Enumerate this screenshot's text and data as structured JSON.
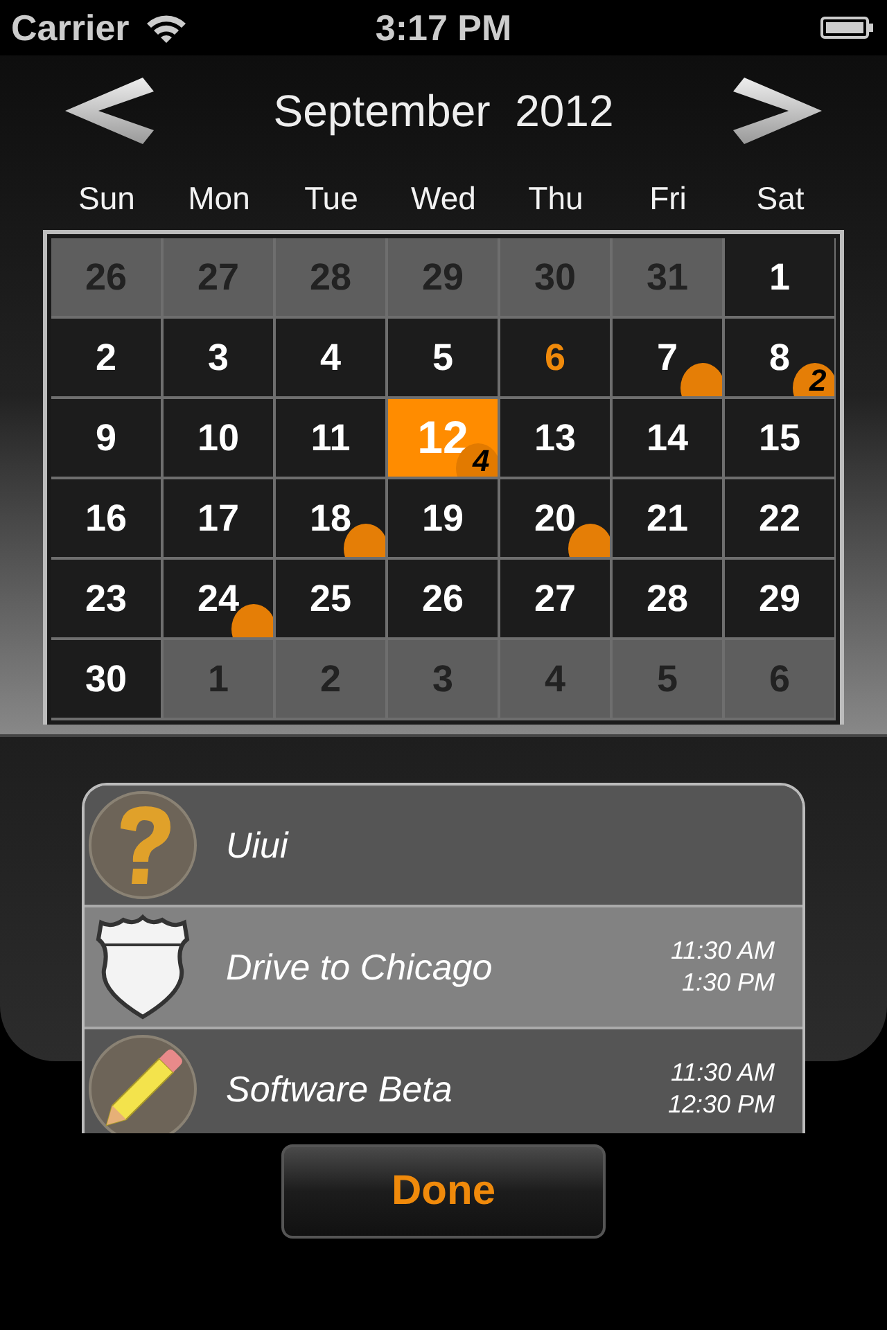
{
  "status_bar": {
    "carrier": "Carrier",
    "time": "3:17 PM"
  },
  "calendar": {
    "title": "September  2012",
    "weekdays": [
      "Sun",
      "Mon",
      "Tue",
      "Wed",
      "Thu",
      "Fri",
      "Sat"
    ],
    "days": [
      {
        "label": "26",
        "in_month": false,
        "today": false,
        "selected": false,
        "events": false
      },
      {
        "label": "27",
        "in_month": false,
        "today": false,
        "selected": false,
        "events": false
      },
      {
        "label": "28",
        "in_month": false,
        "today": false,
        "selected": false,
        "events": false
      },
      {
        "label": "29",
        "in_month": false,
        "today": false,
        "selected": false,
        "events": false
      },
      {
        "label": "30",
        "in_month": false,
        "today": false,
        "selected": false,
        "events": false
      },
      {
        "label": "31",
        "in_month": false,
        "today": false,
        "selected": false,
        "events": false
      },
      {
        "label": "1",
        "in_month": true,
        "today": false,
        "selected": false,
        "events": false
      },
      {
        "label": "2",
        "in_month": true,
        "today": false,
        "selected": false,
        "events": false
      },
      {
        "label": "3",
        "in_month": true,
        "today": false,
        "selected": false,
        "events": false
      },
      {
        "label": "4",
        "in_month": true,
        "today": false,
        "selected": false,
        "events": false
      },
      {
        "label": "5",
        "in_month": true,
        "today": false,
        "selected": false,
        "events": false
      },
      {
        "label": "6",
        "in_month": true,
        "today": true,
        "selected": false,
        "events": false
      },
      {
        "label": "7",
        "in_month": true,
        "today": false,
        "selected": false,
        "events": true
      },
      {
        "label": "8",
        "in_month": true,
        "today": false,
        "selected": false,
        "events": true,
        "count": "2"
      },
      {
        "label": "9",
        "in_month": true,
        "today": false,
        "selected": false,
        "events": false
      },
      {
        "label": "10",
        "in_month": true,
        "today": false,
        "selected": false,
        "events": false
      },
      {
        "label": "11",
        "in_month": true,
        "today": false,
        "selected": false,
        "events": false
      },
      {
        "label": "12",
        "in_month": true,
        "today": false,
        "selected": true,
        "events": true,
        "count": "4"
      },
      {
        "label": "13",
        "in_month": true,
        "today": false,
        "selected": false,
        "events": false
      },
      {
        "label": "14",
        "in_month": true,
        "today": false,
        "selected": false,
        "events": false
      },
      {
        "label": "15",
        "in_month": true,
        "today": false,
        "selected": false,
        "events": false
      },
      {
        "label": "16",
        "in_month": true,
        "today": false,
        "selected": false,
        "events": false
      },
      {
        "label": "17",
        "in_month": true,
        "today": false,
        "selected": false,
        "events": false
      },
      {
        "label": "18",
        "in_month": true,
        "today": false,
        "selected": false,
        "events": true
      },
      {
        "label": "19",
        "in_month": true,
        "today": false,
        "selected": false,
        "events": false
      },
      {
        "label": "20",
        "in_month": true,
        "today": false,
        "selected": false,
        "events": true
      },
      {
        "label": "21",
        "in_month": true,
        "today": false,
        "selected": false,
        "events": false
      },
      {
        "label": "22",
        "in_month": true,
        "today": false,
        "selected": false,
        "events": false
      },
      {
        "label": "23",
        "in_month": true,
        "today": false,
        "selected": false,
        "events": false
      },
      {
        "label": "24",
        "in_month": true,
        "today": false,
        "selected": false,
        "events": true
      },
      {
        "label": "25",
        "in_month": true,
        "today": false,
        "selected": false,
        "events": false
      },
      {
        "label": "26",
        "in_month": true,
        "today": false,
        "selected": false,
        "events": false
      },
      {
        "label": "27",
        "in_month": true,
        "today": false,
        "selected": false,
        "events": false
      },
      {
        "label": "28",
        "in_month": true,
        "today": false,
        "selected": false,
        "events": false
      },
      {
        "label": "29",
        "in_month": true,
        "today": false,
        "selected": false,
        "events": false
      },
      {
        "label": "30",
        "in_month": true,
        "today": false,
        "selected": false,
        "events": false
      },
      {
        "label": "1",
        "in_month": false,
        "today": false,
        "selected": false,
        "events": false
      },
      {
        "label": "2",
        "in_month": false,
        "today": false,
        "selected": false,
        "events": false
      },
      {
        "label": "3",
        "in_month": false,
        "today": false,
        "selected": false,
        "events": false
      },
      {
        "label": "4",
        "in_month": false,
        "today": false,
        "selected": false,
        "events": false
      },
      {
        "label": "5",
        "in_month": false,
        "today": false,
        "selected": false,
        "events": false
      },
      {
        "label": "6",
        "in_month": false,
        "today": false,
        "selected": false,
        "events": false
      }
    ]
  },
  "events": [
    {
      "kind": "question",
      "title": "Uiui",
      "selected": false
    },
    {
      "kind": "route",
      "title": "Drive to Chicago",
      "start": "11:30 AM",
      "end": "1:30 PM",
      "selected": true
    },
    {
      "kind": "pencil",
      "title": "Software Beta",
      "start": "11:30 AM",
      "end": "12:30 PM",
      "selected": false
    }
  ],
  "done_button": "Done"
}
